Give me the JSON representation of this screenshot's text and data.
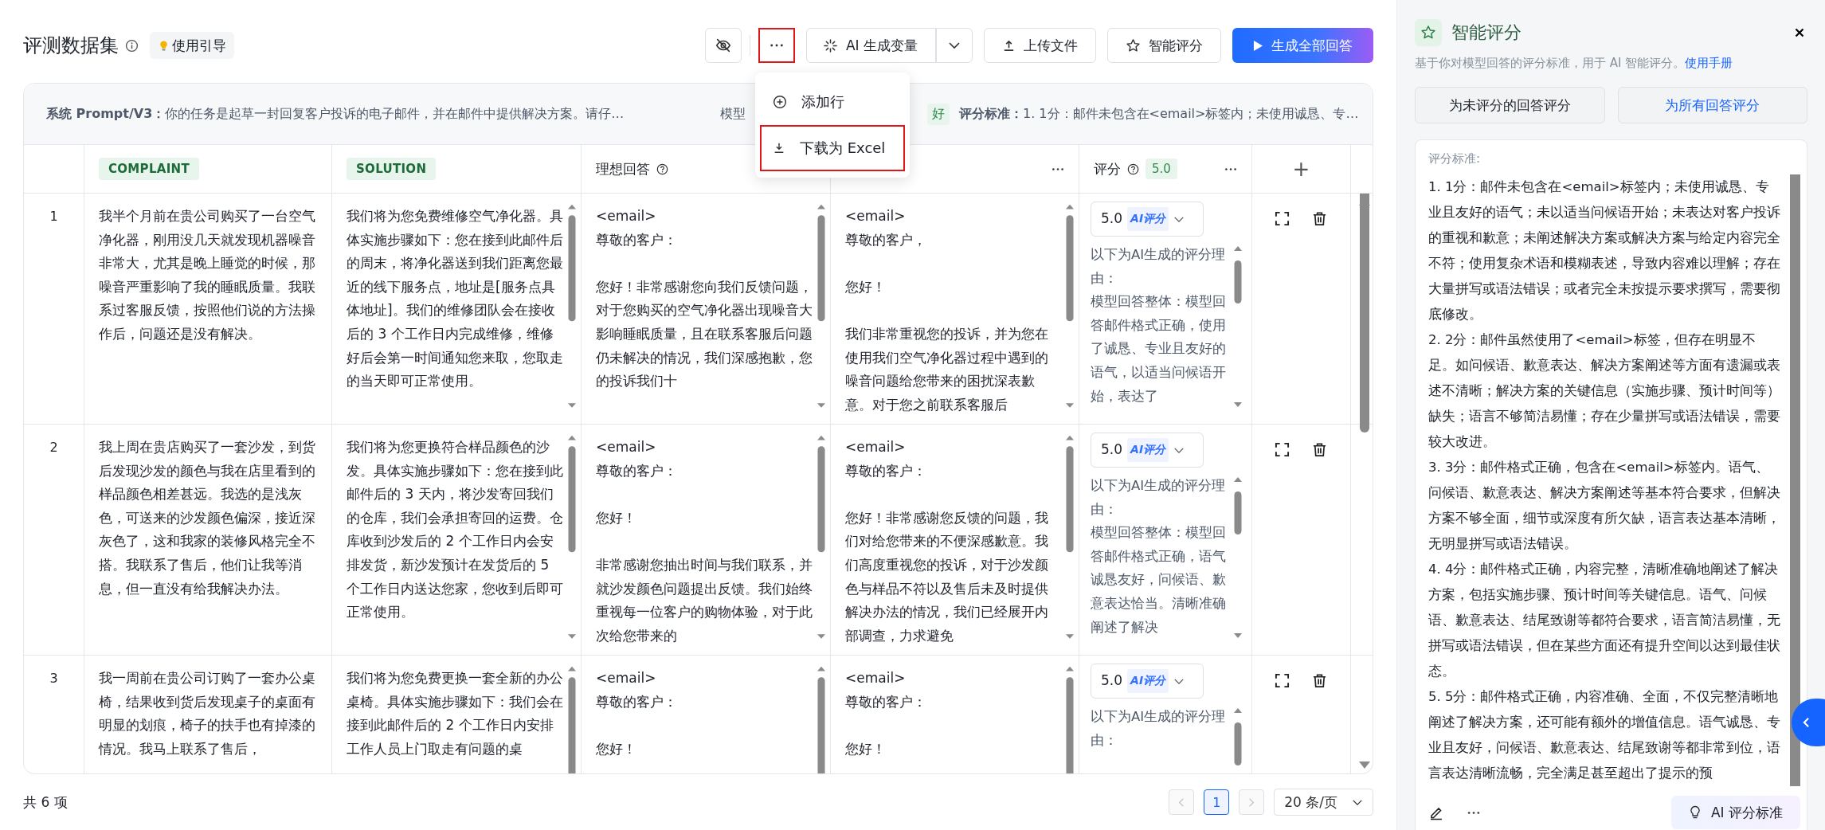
{
  "header": {
    "title": "评测数据集",
    "guide": "使用引导",
    "more_highlighted": true,
    "buttons": [
      {
        "kind": "split",
        "label": "AI 生成变量"
      },
      {
        "kind": "upload",
        "label": "上传文件"
      },
      {
        "kind": "star",
        "label": "智能评分"
      },
      {
        "kind": "primary",
        "label": "生成全部回答"
      }
    ]
  },
  "menu": {
    "items": [
      {
        "kind": "add",
        "label": "添加行",
        "highlighted": false
      },
      {
        "kind": "download",
        "label": "下载为 Excel",
        "highlighted": true
      }
    ]
  },
  "prompt_bar": {
    "system_label": "系统 Prompt/V3：",
    "system_text": "你的任务是起草一封回复客户投诉的电子邮件，并在邮件中提供解决方案。请仔…",
    "model_label": "模型",
    "model_tag": "好",
    "criteria_label": "评分标准：",
    "criteria_text": "1. 1分：邮件未包含在<email>标签内；未使用诚恳、专…"
  },
  "table": {
    "columns": [
      {
        "kind": "variable",
        "label": "COMPLAINT"
      },
      {
        "kind": "variable",
        "label": "SOLUTION"
      },
      {
        "kind": "help",
        "label": "理想回答"
      },
      {
        "kind": "menu"
      },
      {
        "kind": "score",
        "label": "评分",
        "badge": "5.0"
      },
      {
        "kind": "add",
        "label": "+"
      }
    ],
    "rows": [
      {
        "index": "1",
        "cells": [
          {
            "scroll": false,
            "blocks": [
              [
                "我半个月前在贵公司购买了一台空气净化器，刚用没几天就发现机器噪音非常大，尤其是晚上睡觉的时候，那噪音严重影响了我的睡眠质量。我联系过客服反馈，按照他们说的方法操作后，问题还是没有解决。"
              ]
            ]
          },
          {
            "scroll": true,
            "blocks": [
              [
                "我们将为您免费维修空气净化器。具体实施步骤如下：您在接到此邮件后的周末，将净化器送到我们距离您最近的线下服务点，地址是[服务点具体地址]。我们的维修团队会在接收后的 3 个工作日内完成维修，维修好后会第一时间通知您来取，您取走的当天即可正常使用。"
              ]
            ]
          },
          {
            "scroll": true,
            "blocks": [
              [
                "<email>",
                "尊敬的客户："
              ],
              [
                "您好！非常感谢您向我们反馈问题，对于您购买的空气净化器出现噪音大影响睡眠质量，且在联系客服后问题仍未解决的情况，我们深感抱歉，您的投诉我们十"
              ]
            ]
          },
          {
            "scroll": true,
            "blocks": [
              [
                "<email>",
                "尊敬的客户，"
              ],
              [
                "您好！"
              ],
              [
                "我们非常重视您的投诉，并为您在使用我们空气净化器过程中遇到的噪音问题给您带来的困扰深表歉意。对于您之前联系客服后"
              ]
            ]
          }
        ],
        "score": {
          "value": "5.0",
          "tag": "AI评分",
          "reason": [
            "以下为AI生成的评分理由：",
            "模型回答整体：模型回答邮件格式正确，使用了诚恳、专业且友好的语气，以适当问候语开始，表达了"
          ]
        }
      },
      {
        "index": "2",
        "cells": [
          {
            "scroll": false,
            "blocks": [
              [
                "我上周在贵店购买了一套沙发，到货后发现沙发的颜色与我在店里看到的样品颜色相差甚远。我选的是浅灰色，可送来的沙发颜色偏深，接近深灰色了，这和我家的装修风格完全不搭。我联系了售后，他们让我等消息，但一直没有给我解决办法。"
              ]
            ]
          },
          {
            "scroll": true,
            "blocks": [
              [
                "我们将为您更换符合样品颜色的沙发。具体实施步骤如下：您在接到此邮件后的 3 天内，将沙发寄回我们的仓库，我们会承担寄回的运费。仓库收到沙发后的 2 个工作日内会安排发货，新沙发预计在发货后的 5 个工作日内送达您家，您收到后即可正常使用。"
              ]
            ]
          },
          {
            "scroll": true,
            "blocks": [
              [
                "<email>",
                "尊敬的客户："
              ],
              [
                "您好！"
              ],
              [
                "非常感谢您抽出时间与我们联系，并就沙发颜色问题提出反馈。我们始终重视每一位客户的购物体验，对于此次给您带来的"
              ]
            ]
          },
          {
            "scroll": true,
            "blocks": [
              [
                "<email>",
                "尊敬的客户："
              ],
              [
                "您好！非常感谢您反馈的问题，我们对给您带来的不便深感歉意。我们高度重视您的投诉，对于沙发颜色与样品不符以及售后未及时提供解决办法的情况，我们已经展开内部调查，力求避免"
              ]
            ]
          }
        ],
        "score": {
          "value": "5.0",
          "tag": "AI评分",
          "reason": [
            "以下为AI生成的评分理由：",
            "模型回答整体：模型回答邮件格式正确，语气诚恳友好，问候语、歉意表达恰当。清晰准确阐述了解决"
          ]
        }
      },
      {
        "index": "3",
        "cells": [
          {
            "scroll": false,
            "blocks": [
              [
                "我一周前在贵公司订购了一套办公桌椅，结果收到货后发现桌子的桌面有明显的划痕，椅子的扶手也有掉漆的情况。我马上联系了售后，"
              ]
            ]
          },
          {
            "scroll": true,
            "blocks": [
              [
                "我们将为您免费更换一套全新的办公桌椅。具体实施步骤如下：我们会在接到此邮件后的 2 个工作日内安排工作人员上门取走有问题的桌"
              ]
            ]
          },
          {
            "scroll": true,
            "blocks": [
              [
                "<email>",
                "尊敬的客户："
              ],
              [
                "您好！"
              ]
            ]
          },
          {
            "scroll": true,
            "blocks": [
              [
                "<email>",
                "尊敬的客户："
              ],
              [
                "您好！"
              ]
            ]
          }
        ],
        "score": {
          "value": "5.0",
          "tag": "AI评分",
          "reason": [
            "以下为AI生成的评分理由："
          ]
        }
      }
    ]
  },
  "footer": {
    "total": "共 6 项",
    "prev_disabled": true,
    "next_disabled": true,
    "pages": [
      {
        "label": "1",
        "selected": true
      }
    ],
    "page_size": "20 条/页"
  },
  "panel": {
    "title": "智能评分",
    "description": "基于你对模型回答的评分标准，用于 AI 智能评分。",
    "link": "使用手册",
    "buttons": [
      {
        "label": "为未评分的回答评分",
        "primary": false
      },
      {
        "label": "为所有回答评分",
        "primary": true
      }
    ],
    "criteria_label": "评分标准:",
    "criteria": [
      "1. 1分：邮件未包含在<email>标签内；未使用诚恳、专业且友好的语气；未以适当问候语开始；未表达对客户投诉的重视和歉意；未阐述解决方案或解决方案与给定内容完全不符；使用复杂术语和模糊表述，导致内容难以理解；存在大量拼写或语法错误；或者完全未按提示要求撰写，需要彻底修改。",
      "2. 2分：邮件虽然使用了<email>标签，但存在明显不足。如问候语、歉意表达、解决方案阐述等方面有遗漏或表述不清晰；解决方案的关键信息（实施步骤、预计时间等）缺失；语言不够简洁易懂；存在少量拼写或语法错误，需要较大改进。",
      "3. 3分：邮件格式正确，包含在<email>标签内。语气、问候语、歉意表达、解决方案阐述等基本符合要求，但解决方案不够全面，细节或深度有所欠缺，语言表达基本清晰，无明显拼写或语法错误。",
      "4. 4分：邮件格式正确，内容完整，清晰准确地阐述了解决方案，包括实施步骤、预计时间等关键信息。语气、问候语、歉意表达、结尾致谢等都符合要求，语言简洁易懂，无拼写或语法错误，但在某些方面还有提升空间以达到最佳状态。",
      "5. 5分：邮件格式正确，内容准确、全面，不仅完整清晰地阐述了解决方案，还可能有额外的增值信息。语气诚恳、专业且友好，问候语、歉意表达、结尾致谢等都非常到位，语言表达清晰流畅，完全满足甚至超出了提示的预"
    ],
    "ai_button": "AI 评分标准"
  }
}
